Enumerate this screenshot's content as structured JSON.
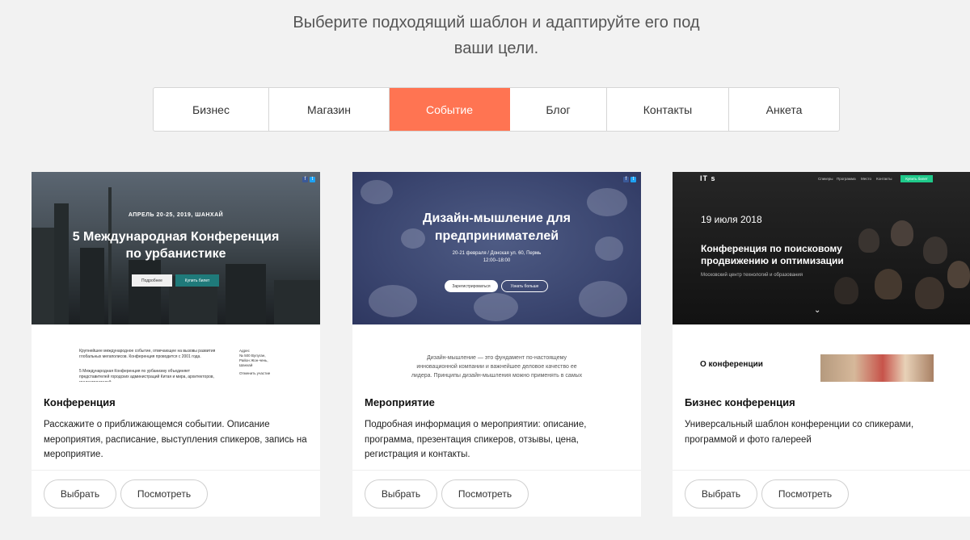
{
  "heading": {
    "line1": "Выберите подходящий шаблон и адаптируйте его под",
    "line2": "ваши цели."
  },
  "tabs": [
    {
      "label": "Бизнес",
      "active": false
    },
    {
      "label": "Магазин",
      "active": false
    },
    {
      "label": "Событие",
      "active": true
    },
    {
      "label": "Блог",
      "active": false
    },
    {
      "label": "Контакты",
      "active": false
    },
    {
      "label": "Анкета",
      "active": false
    }
  ],
  "accent_color": "#ff7452",
  "cards": [
    {
      "title": "Конференция",
      "description": "Расскажите о приближающемся событии. Описание мероприятия, расписание, выступления спикеров, запись на мероприятие.",
      "select_label": "Выбрать",
      "view_label": "Посмотреть",
      "preview": {
        "date": "АПРЕЛЬ 20-25, 2019, ШАНХАЙ",
        "title_line1": "5 Международная Конференция",
        "title_line2": "по урбанистике",
        "btn1": "Подробнее",
        "btn2": "Купить билет",
        "body1": "Крупнейшее международное событие, отвечающее на вызовы развития глобальных мегаполисов. Конференция проводится с 2001 года.",
        "body2": "5 Международная Конференция по урбанизму объединяет представителей городских администраций Китая и мира, архитекторов, градостроителей,",
        "side1": "Адрес",
        "side2": "№ 500 Вулуган,",
        "side3": "Район Жон-чень,",
        "side4": "Шанхай",
        "side5": "Отменить участие"
      }
    },
    {
      "title": "Мероприятие",
      "description": "Подробная информация о мероприятии: описание, программа, презентация спикеров, отзывы, цена, регистрация и контакты.",
      "select_label": "Выбрать",
      "view_label": "Посмотреть",
      "preview": {
        "title_line1": "Дизайн-мышление для",
        "title_line2": "предпринимателей",
        "sub1": "20-21 февраля / Донская ул. 60, Пермь",
        "sub2": "12:00–18:00",
        "btn1": "Зарегистрироваться",
        "btn2": "Узнать больше",
        "body1": "Дизайн-мышление — это фундамент по-настоящему",
        "body2": "инновационной компании и важнейшее деловое качество ее",
        "body3": "лидера. Принципы дизайн-мышления можно применять в самых"
      }
    },
    {
      "title": "Бизнес конференция",
      "description": "Универсальный шаблон конференции со спикерами, программой и фото галереей",
      "select_label": "Выбрать",
      "view_label": "Посмотреть",
      "preview": {
        "logo": "IT   s",
        "nav": [
          "Спикеры",
          "Программа",
          "Место",
          "Контакты"
        ],
        "nav_btn": "Купить билет",
        "date": "19 июля 2018",
        "title_line1": "Конференция по поисковому",
        "title_line2": "продвижению и оптимизации",
        "subtitle": "Московский центр технологий и образования",
        "about": "О конференции"
      }
    }
  ]
}
